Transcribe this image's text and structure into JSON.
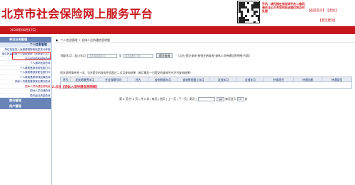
{
  "header": {
    "title": "北京市社会保险网上服务平台",
    "qr_note": "手机：请扫描在线咨询平台二维码请关注公众号您的投诉建议将及时处理",
    "links_top": [
      "返回首页",
      "退出"
    ],
    "links_bottom": "意见建议"
  },
  "bar": {
    "date": "2020年08月17日"
  },
  "sidebar": {
    "section1": "单位业务管理",
    "section1_sub": "个人信息管理",
    "items": [
      "单位批量录入及缴费基数等信息变动申报",
      "单位批量申报个人缴费基数（含新增人员）",
      "社会保险费明细账查询",
      "个人缴纳信息查询",
      "个人缴费基数申报信息打印",
      "个人缴费基数变更信息打印",
      "个人缴费基数审核结果查询",
      "参保人员缴费基数核定情况查询",
      "退休人员待遇信息明细",
      "退休人员待遇查询",
      "稳岗返还资金查询"
    ],
    "section2": "委托管理",
    "section3": "用户管理"
  },
  "main": {
    "breadcrumb": "个人信息管理 > 退休人员待遇信息明细",
    "search": {
      "label_range": "领取年月：起止年月",
      "placeholder_from": "请选择起始年月",
      "to_label": "至",
      "placeholder_to": "请选择截止年月",
      "query_button": "提交查询",
      "hint": "（点击\"提交查询\"按钮开始查询\"退休人员待遇信息明细\"内容）"
    },
    "note": "相关说明请参考一次、当天提交的查询不宜超过二次且查询结果（每月最后一日提交的查询不允许日查询结果）",
    "table": {
      "headers": [
        "序号",
        "发放期缴费年月",
        "社会保障号码",
        "姓名",
        "查询数据年月",
        "查询数据截止年月",
        "发放年月",
        "发放年月",
        "待遇项目",
        "待遇金额",
        "待遇类型"
      ]
    },
    "step_note": "2.点击【退休人员待遇信息明细】",
    "pager": {
      "text": "第 0 页/共 0 页 | 共 0 条 | 每页 | 首页 | 上一页 | 下一页 | 尾页 |",
      "go": "go",
      "size_label": "每页显示",
      "size": "10",
      "unit": "条"
    }
  },
  "colors": {
    "brand_red": "#c8161d",
    "sidebar_header": "#6985b8",
    "highlight": "#e0202a"
  }
}
